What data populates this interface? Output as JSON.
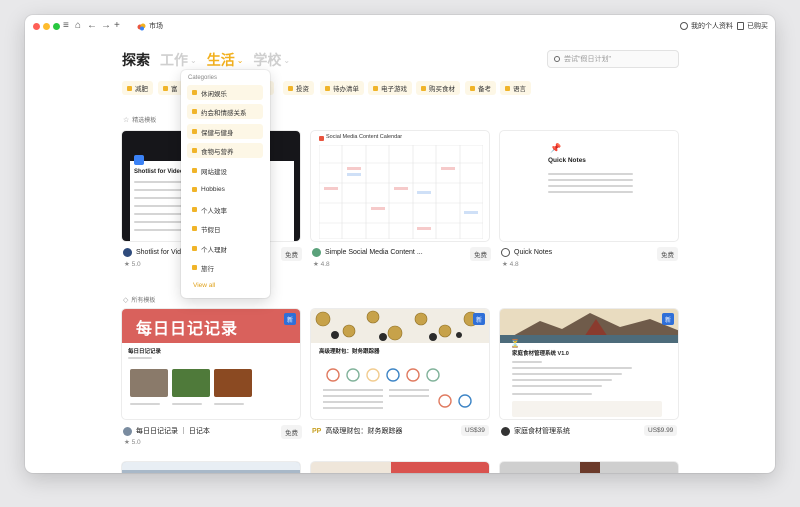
{
  "titlebar": {
    "breadcrumb": "市场",
    "profile_label": "我的个人资料",
    "purchased_label": "已购买"
  },
  "tabs": [
    {
      "label": "探索"
    },
    {
      "label": "工作"
    },
    {
      "label": "生活"
    },
    {
      "label": "学校"
    }
  ],
  "search": {
    "placeholder": "尝试\"假日计划\""
  },
  "chips": [
    {
      "label": "减肥"
    },
    {
      "label": "富"
    },
    {
      "label": "育"
    },
    {
      "label": "投资"
    },
    {
      "label": "待办清单"
    },
    {
      "label": "电子游戏"
    },
    {
      "label": "购买食材"
    },
    {
      "label": "备考"
    },
    {
      "label": "语言"
    }
  ],
  "dropdown": {
    "header": "Categories",
    "items": [
      {
        "label": "休闲娱乐"
      },
      {
        "label": "约会和情感关系"
      },
      {
        "label": "保健与健身"
      },
      {
        "label": "食物与营养"
      },
      {
        "label": "网站建设"
      },
      {
        "label": "Hobbies"
      },
      {
        "label": "个人效率"
      },
      {
        "label": "节假日"
      },
      {
        "label": "个人理财"
      },
      {
        "label": "旅行"
      }
    ],
    "view_all": "View all"
  },
  "featured": {
    "label": "精选模板",
    "cards": [
      {
        "title": "Shotlist for Vide",
        "thumb_title": "Shotlist for Video Co",
        "price": "免费",
        "rating": "5.0"
      },
      {
        "title": "Simple Social Media Content ...",
        "thumb_title": "Social Media Content Calendar",
        "price": "免费",
        "rating": "4.8"
      },
      {
        "title": "Quick Notes",
        "thumb_title": "Quick Notes",
        "price": "免费",
        "rating": "4.8"
      }
    ]
  },
  "all": {
    "label": "所有模板",
    "cards": [
      {
        "title": "每日日记记录 ｜ 日记本",
        "banner": "每日日记记录",
        "thumb_title": "每日日记记录",
        "price": "免费",
        "rating": "5.0",
        "badge": "新"
      },
      {
        "title": "高级理财包：财务跟踪器",
        "thumb_title": "高级理财包：财务跟踪器",
        "price": "US$39",
        "badge": "新"
      },
      {
        "title": "家庭食材管理系统",
        "thumb_title": "家庭食材管理系统 V1.0",
        "price": "US$9.99",
        "badge": "新"
      }
    ]
  },
  "colors": {
    "accent": "#f2b01e",
    "chip_bg": "#fdf7e6",
    "badge": "#2f6fd8"
  }
}
